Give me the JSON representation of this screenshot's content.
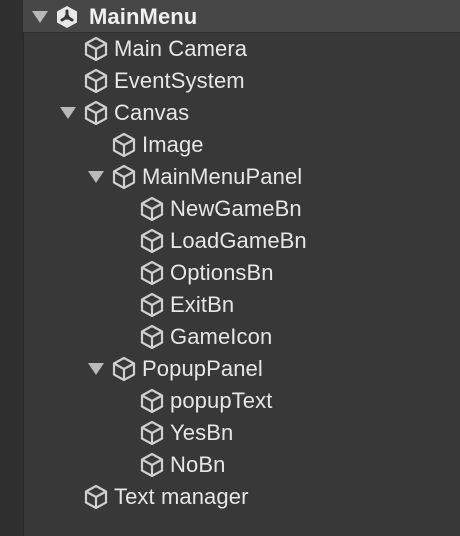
{
  "hierarchy": {
    "scene": {
      "name": "MainMenu",
      "icon": "unity-logo-icon",
      "expanded": true
    },
    "items": [
      {
        "label": "Main Camera",
        "icon": "gameobject-cube-icon"
      },
      {
        "label": "EventSystem",
        "icon": "gameobject-cube-icon"
      },
      {
        "label": "Canvas",
        "icon": "gameobject-cube-icon",
        "expanded": true
      },
      {
        "label": "Image",
        "icon": "gameobject-cube-icon"
      },
      {
        "label": "MainMenuPanel",
        "icon": "gameobject-cube-icon",
        "expanded": true
      },
      {
        "label": "NewGameBn",
        "icon": "gameobject-cube-icon"
      },
      {
        "label": "LoadGameBn",
        "icon": "gameobject-cube-icon"
      },
      {
        "label": "OptionsBn",
        "icon": "gameobject-cube-icon"
      },
      {
        "label": "ExitBn",
        "icon": "gameobject-cube-icon"
      },
      {
        "label": "GameIcon",
        "icon": "gameobject-cube-icon"
      },
      {
        "label": "PopupPanel",
        "icon": "gameobject-cube-icon",
        "expanded": true
      },
      {
        "label": "popupText",
        "icon": "gameobject-cube-icon"
      },
      {
        "label": "YesBn",
        "icon": "gameobject-cube-icon"
      },
      {
        "label": "NoBn",
        "icon": "gameobject-cube-icon"
      },
      {
        "label": "Text manager",
        "icon": "gameobject-cube-icon"
      }
    ]
  }
}
